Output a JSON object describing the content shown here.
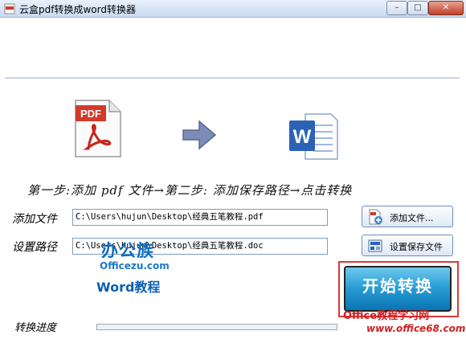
{
  "window": {
    "title": "云盒pdf转换成word转换器",
    "min_symbol": "–",
    "max_symbol": "□",
    "close_symbol": "✕"
  },
  "instructions": {
    "step_text": "第一步:添加 pdf 文件→第二步: 添加保存路径→点击转换"
  },
  "add_file": {
    "label": "添加文件",
    "value": "C:\\Users\\hujun\\Desktop\\经典五笔教程.pdf",
    "button_label": "添加文件..."
  },
  "save_path": {
    "label": "设置路径",
    "value": "C:\\Users\\hujun\\Desktop\\经典五笔教程.doc",
    "button_label": "设置保存文件"
  },
  "start": {
    "button_label": "开始转换"
  },
  "progress": {
    "label": "转换进度",
    "value": 0
  },
  "watermark": {
    "brand": "办公族",
    "brand_url": "Officezu.com",
    "brand_sub": "Word教程",
    "right_line1": "Office教程学习网",
    "right_line2": "www.office68.com"
  },
  "icons": {
    "app": "pdf-app-icon",
    "pdf": "pdf-file-icon",
    "arrow": "right-arrow-icon",
    "word": "word-file-icon",
    "add": "add-file-icon",
    "save": "save-settings-icon"
  },
  "colors": {
    "start_button": "#2b9fd6",
    "highlight_frame": "#d83a3a",
    "pdf_red": "#d23a2a",
    "word_blue": "#2b62b5"
  }
}
